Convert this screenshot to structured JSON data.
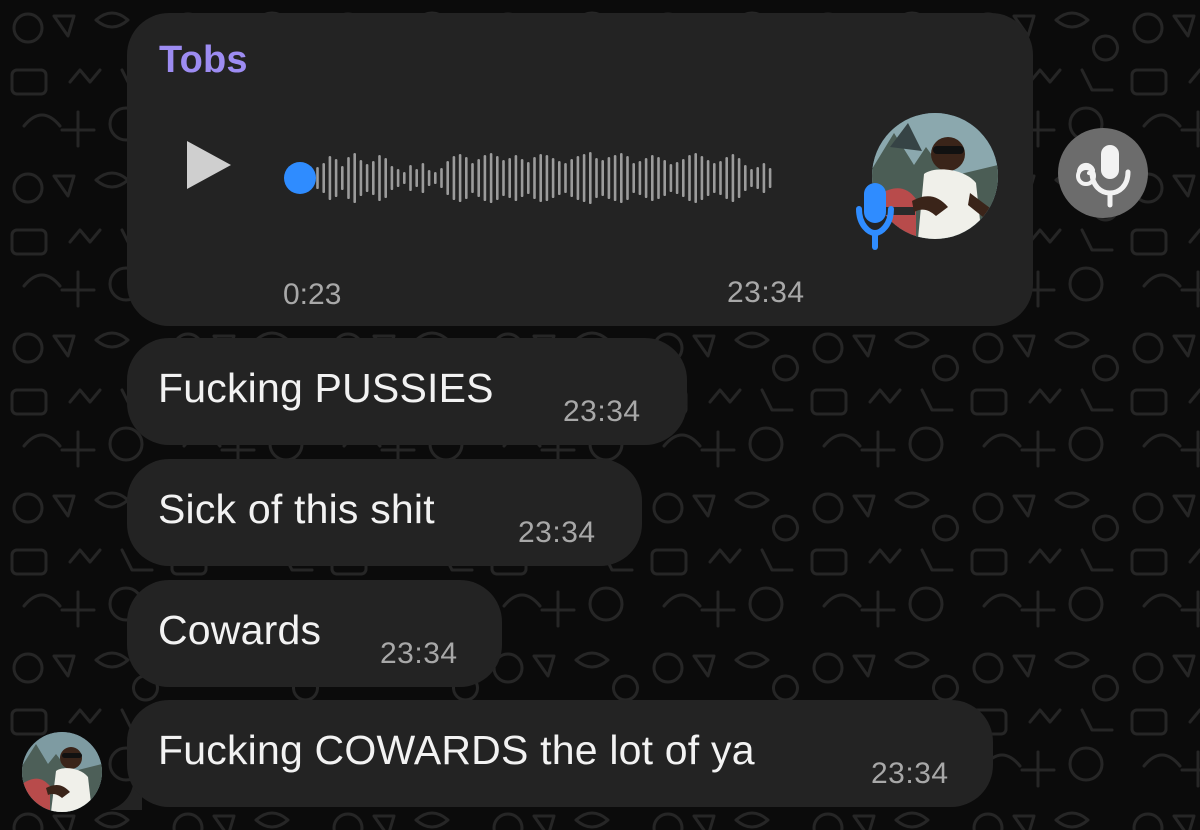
{
  "colors": {
    "background": "#0b0b0b",
    "bubble": "#232323",
    "sender": "#9d8cf2",
    "time": "#a8a8a8",
    "text": "#f2f2f2",
    "waveform": "#9b9b9b",
    "progress_dot": "#2f8cff",
    "mic": "#2f8cff",
    "side_button": "#6c6c6c"
  },
  "voice_message": {
    "sender": "Tobs",
    "duration": "0:23",
    "time": "23:34",
    "progress": 0,
    "play_icon": "play-icon",
    "mic_icon": "microphone-icon"
  },
  "side_action": {
    "icon": "voice-transcription-icon"
  },
  "messages": [
    {
      "text": "Fucking PUSSIES",
      "time": "23:34"
    },
    {
      "text": "Sick of this shit",
      "time": "23:34"
    },
    {
      "text": "Cowards",
      "time": "23:34"
    },
    {
      "text": "Fucking COWARDS the lot of ya",
      "time": "23:34"
    }
  ]
}
